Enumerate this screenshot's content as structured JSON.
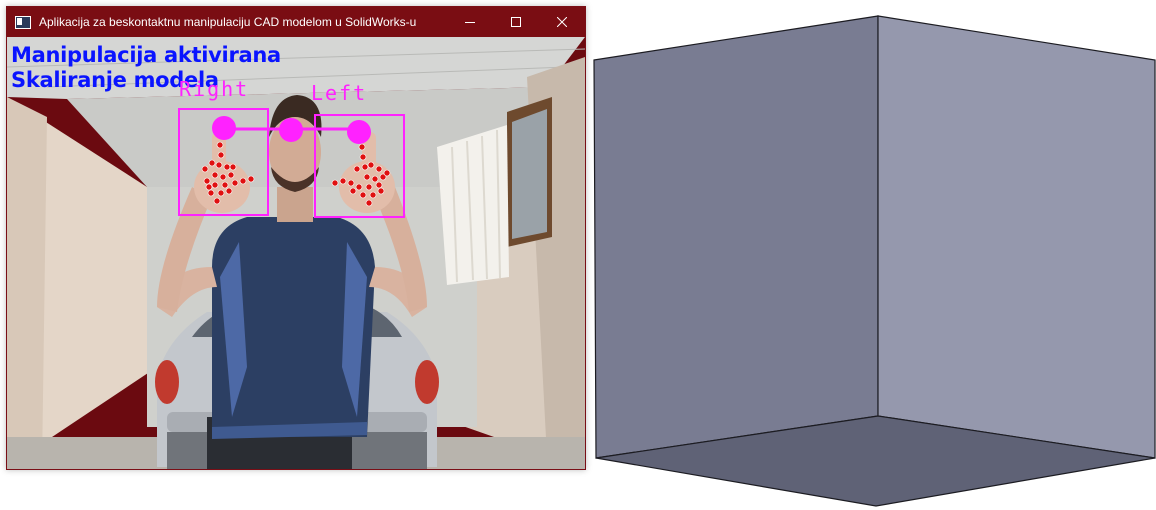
{
  "window": {
    "title": "Aplikacija za beskontaktnu manipulaciju CAD modelom u SolidWorks-u",
    "icon": "app-window-icon",
    "controls": [
      "minimize-icon",
      "maximize-icon",
      "close-icon"
    ]
  },
  "overlay": {
    "status_line_1": "Manipulacija aktivirana",
    "status_line_2": "Skaliranje modela",
    "right_hand_label": "Right",
    "left_hand_label": "Left",
    "text_color": "#0a14ff",
    "tracking_color": "#ff22ff",
    "landmark_color": "#e01010"
  },
  "cad": {
    "model": "cube",
    "face_colors": {
      "left": "#797c92",
      "right": "#9598ad",
      "bottom": "#5f6276"
    }
  }
}
